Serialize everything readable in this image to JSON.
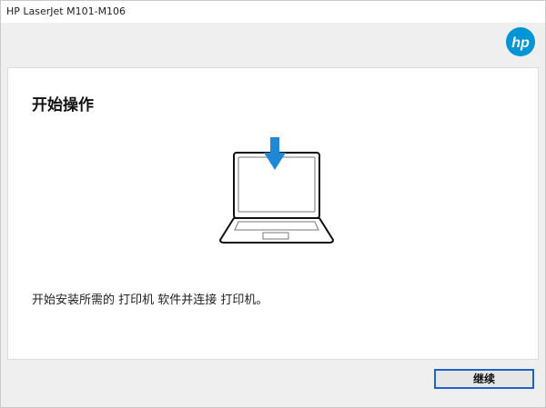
{
  "window": {
    "title": "HP LaserJet M101-M106"
  },
  "brand": {
    "logo": "hp-logo-icon",
    "logo_color": "#0096d6",
    "logo_text": "hp"
  },
  "main": {
    "heading": "开始操作",
    "illustration_icon": "laptop-download-icon",
    "arrow_color": "#1e88d6",
    "instruction": "开始安装所需的 打印机 软件并连接 打印机。"
  },
  "footer": {
    "continue_label": "继续",
    "button_border_color": "#1e63c8"
  }
}
